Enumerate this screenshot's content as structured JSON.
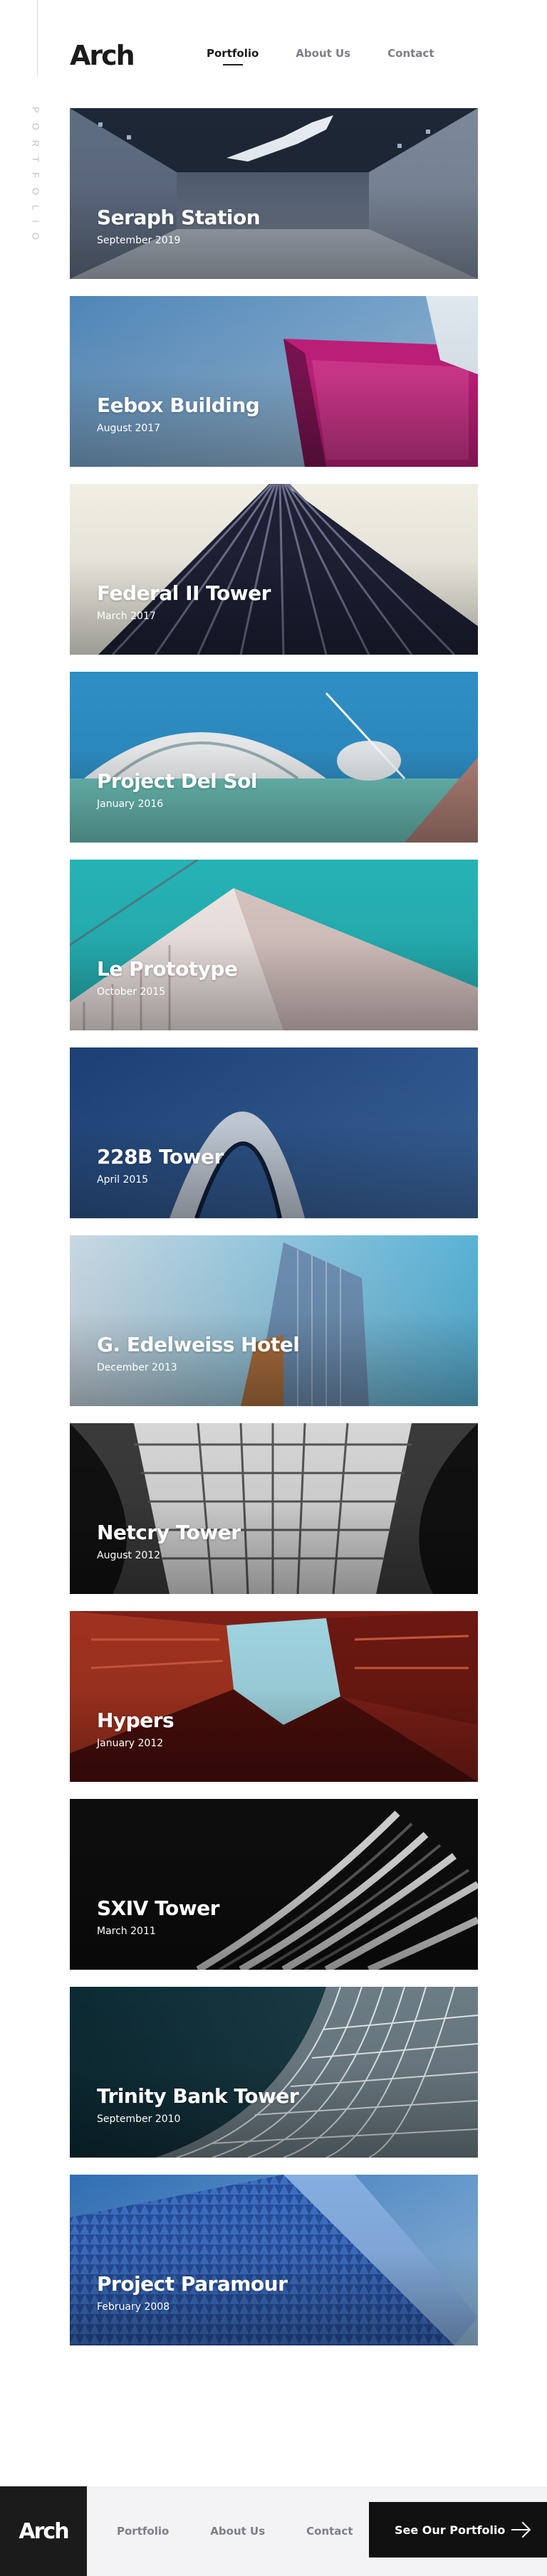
{
  "brand": {
    "logo_text": "Arch"
  },
  "sidebar": {
    "label": "PORTFOLIO"
  },
  "nav": {
    "items": [
      {
        "label": "Portfolio",
        "active": true
      },
      {
        "label": "About Us",
        "active": false
      },
      {
        "label": "Contact",
        "active": false
      }
    ]
  },
  "projects": [
    {
      "title": "Seraph Station",
      "date": "September 2019",
      "image": "station-interior-image"
    },
    {
      "title": "Eebox Building",
      "date": "August 2017",
      "image": "magenta-glass-building-image"
    },
    {
      "title": "Federal II Tower",
      "date": "March 2017",
      "image": "striped-tower-image"
    },
    {
      "title": "Project Del Sol",
      "date": "January 2016",
      "image": "white-curved-building-image"
    },
    {
      "title": "Le Prototype",
      "date": "October 2015",
      "image": "white-balcony-building-image"
    },
    {
      "title": "228B Tower",
      "date": "April 2015",
      "image": "arch-tower-image"
    },
    {
      "title": "G. Edelweiss Hotel",
      "date": "December 2013",
      "image": "glass-hotel-image"
    },
    {
      "title": "Netcry Tower",
      "date": "August 2012",
      "image": "grid-facade-image"
    },
    {
      "title": "Hypers",
      "date": "January 2012",
      "image": "red-courtyard-image"
    },
    {
      "title": "SXIV Tower",
      "date": "March 2011",
      "image": "wavy-facade-image"
    },
    {
      "title": "Trinity Bank Tower",
      "date": "September 2010",
      "image": "curved-glass-tower-image"
    },
    {
      "title": "Project Paramour",
      "date": "February 2008",
      "image": "blue-pattern-tower-image"
    }
  ],
  "footer": {
    "logo_text": "Arch",
    "nav": [
      {
        "label": "Portfolio"
      },
      {
        "label": "About Us"
      },
      {
        "label": "Contact"
      }
    ],
    "cta_label": "See Our Portfolio"
  }
}
